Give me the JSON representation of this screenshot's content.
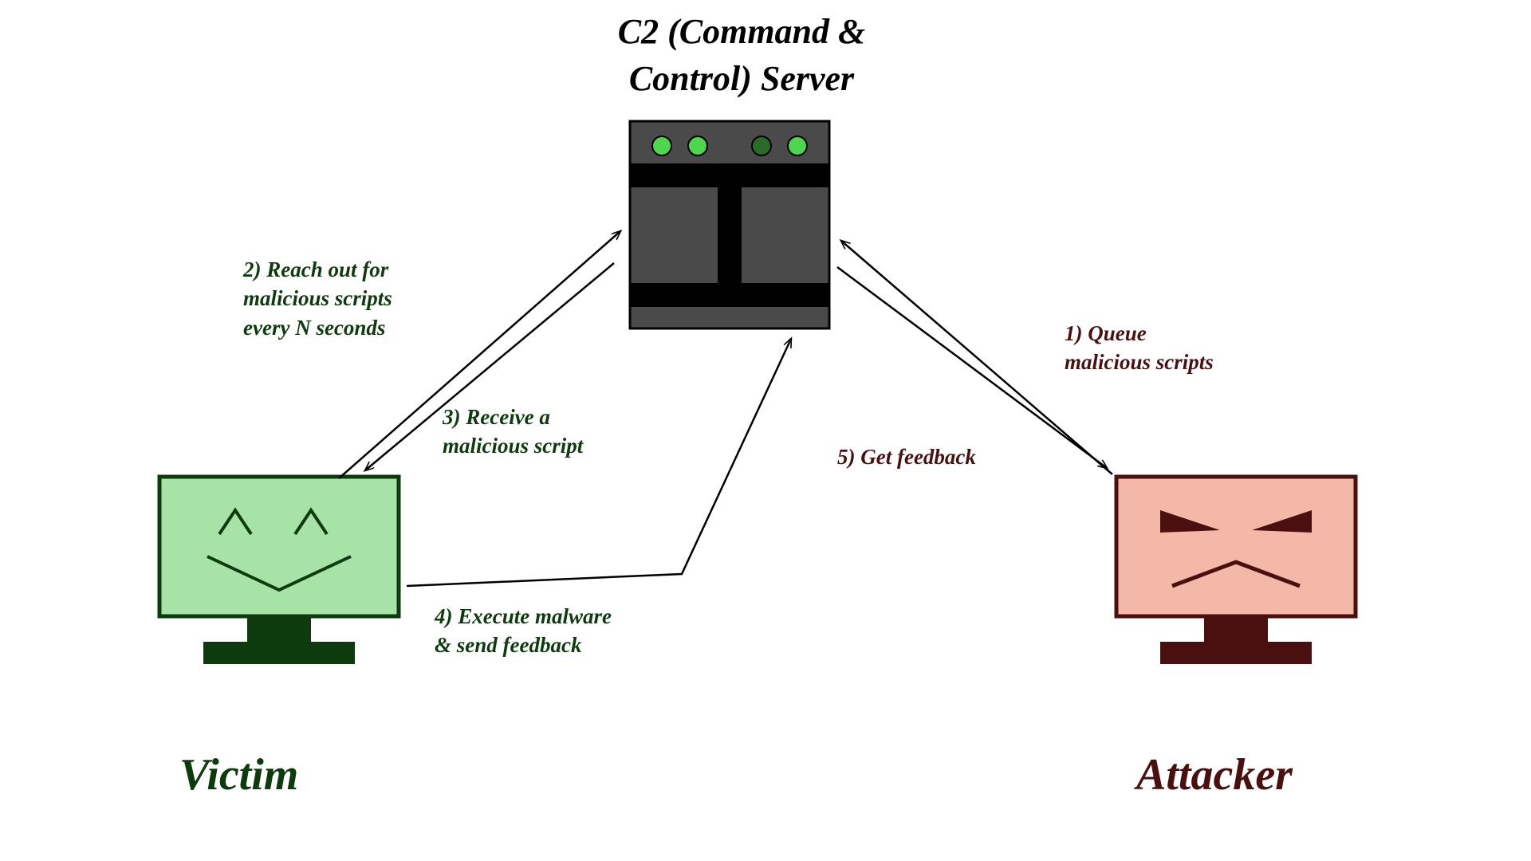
{
  "title_line1": "C2 (Command &",
  "title_line2": "Control) Server",
  "victim_label": "Victim",
  "attacker_label": "Attacker",
  "step1_line1": "1) Queue",
  "step1_line2": "malicious scripts",
  "step2_line1": "2) Reach out for",
  "step2_line2": "malicious scripts",
  "step2_line3": "every N seconds",
  "step3_line1": "3) Receive a",
  "step3_line2": "malicious script",
  "step4_line1": "4) Execute malware",
  "step4_line2": "& send feedback",
  "step5": "5) Get feedback",
  "colors": {
    "victim_fill": "#a7e2a7",
    "victim_stroke": "#0d3b0d",
    "attacker_fill": "#f3b8a8",
    "attacker_stroke": "#4a1010",
    "server_body": "#4a4a4a",
    "server_dark": "#000000",
    "led_on": "#4fd64f",
    "led_dim": "#2a6b2a"
  }
}
